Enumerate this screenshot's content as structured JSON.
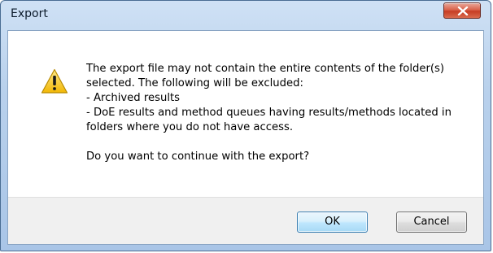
{
  "window": {
    "title": "Export"
  },
  "icon": {
    "type": "warning-icon",
    "color": "#f4c21b"
  },
  "message": {
    "lines": [
      "The export file may not contain the entire contents of the folder(s)",
      "selected. The following will be excluded:",
      "- Archived results",
      "- DoE results and method queues having results/methods located in",
      "folders where you do not have access."
    ],
    "question": "Do you want to continue with the export?"
  },
  "buttons": {
    "ok_label": "OK",
    "cancel_label": "Cancel"
  },
  "colors": {
    "title_bar": "#b9d1ec",
    "close_button": "#c63d24",
    "footer": "#f0f0f0",
    "default_button_border": "#3c7fb1"
  }
}
